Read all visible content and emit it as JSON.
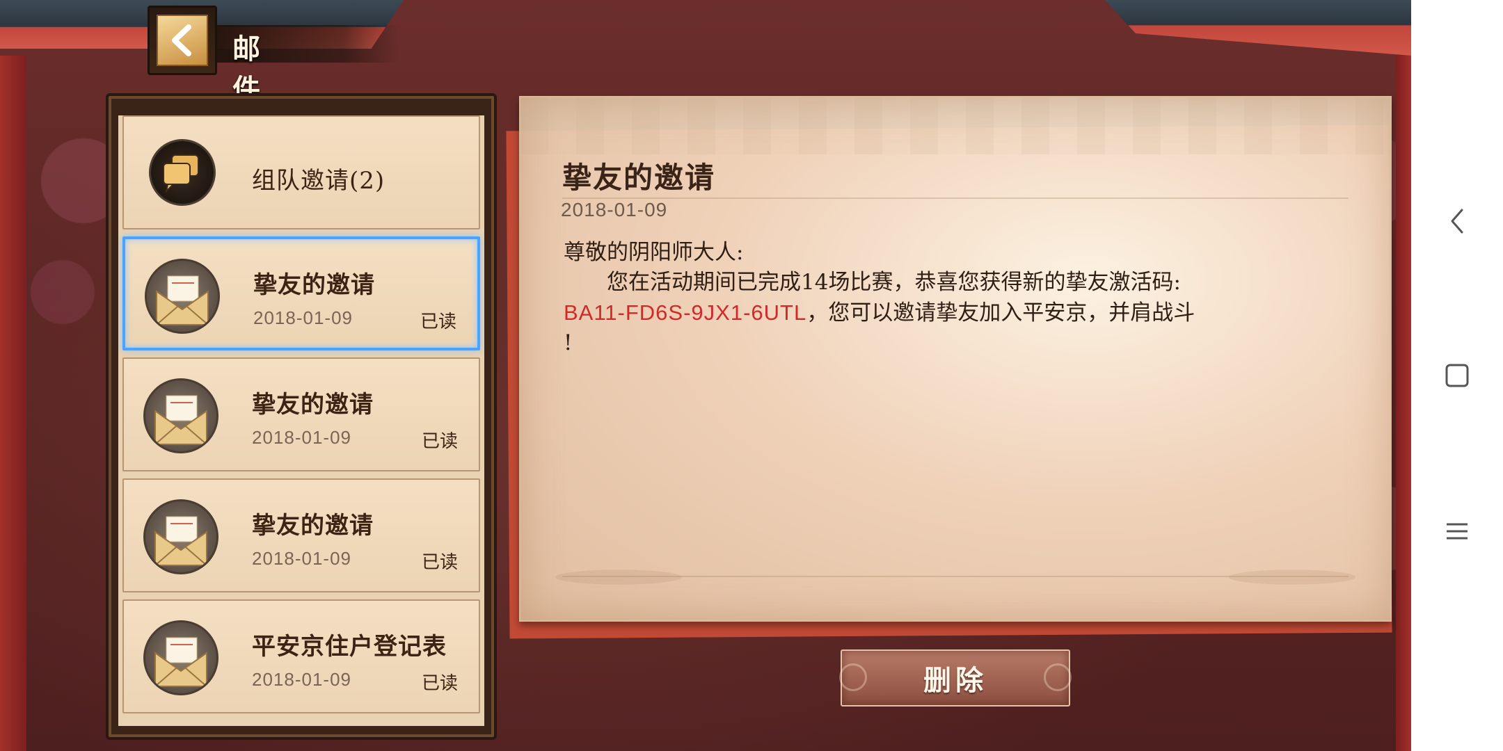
{
  "header": {
    "title": "邮件"
  },
  "mail_list": [
    {
      "title": "组队邀请(2)",
      "date": "",
      "status": "",
      "icon": "chat-bubbles-icon"
    },
    {
      "title": "挚友的邀请",
      "date": "2018-01-09",
      "status": "已读",
      "icon": "envelope-icon"
    },
    {
      "title": "挚友的邀请",
      "date": "2018-01-09",
      "status": "已读",
      "icon": "envelope-icon"
    },
    {
      "title": "挚友的邀请",
      "date": "2018-01-09",
      "status": "已读",
      "icon": "envelope-icon"
    },
    {
      "title": "平安京住户登记表",
      "date": "2018-01-09",
      "status": "已读",
      "icon": "envelope-icon"
    }
  ],
  "letter": {
    "title": "挚友的邀请",
    "date": "2018-01-09",
    "greeting": "尊敬的阴阳师大人:",
    "line1": "您在活动期间已完成14场比赛，恭喜您获得新的挚友激活码:",
    "code": "BA11-FD6S-9JX1-6UTL",
    "line2_after_code": "，您可以邀请挚友加入平安京，并肩战斗",
    "line3": "!"
  },
  "actions": {
    "delete_label": "删除"
  },
  "colors": {
    "selected_border": "#4aa3ff",
    "code_red": "#d3282a"
  }
}
